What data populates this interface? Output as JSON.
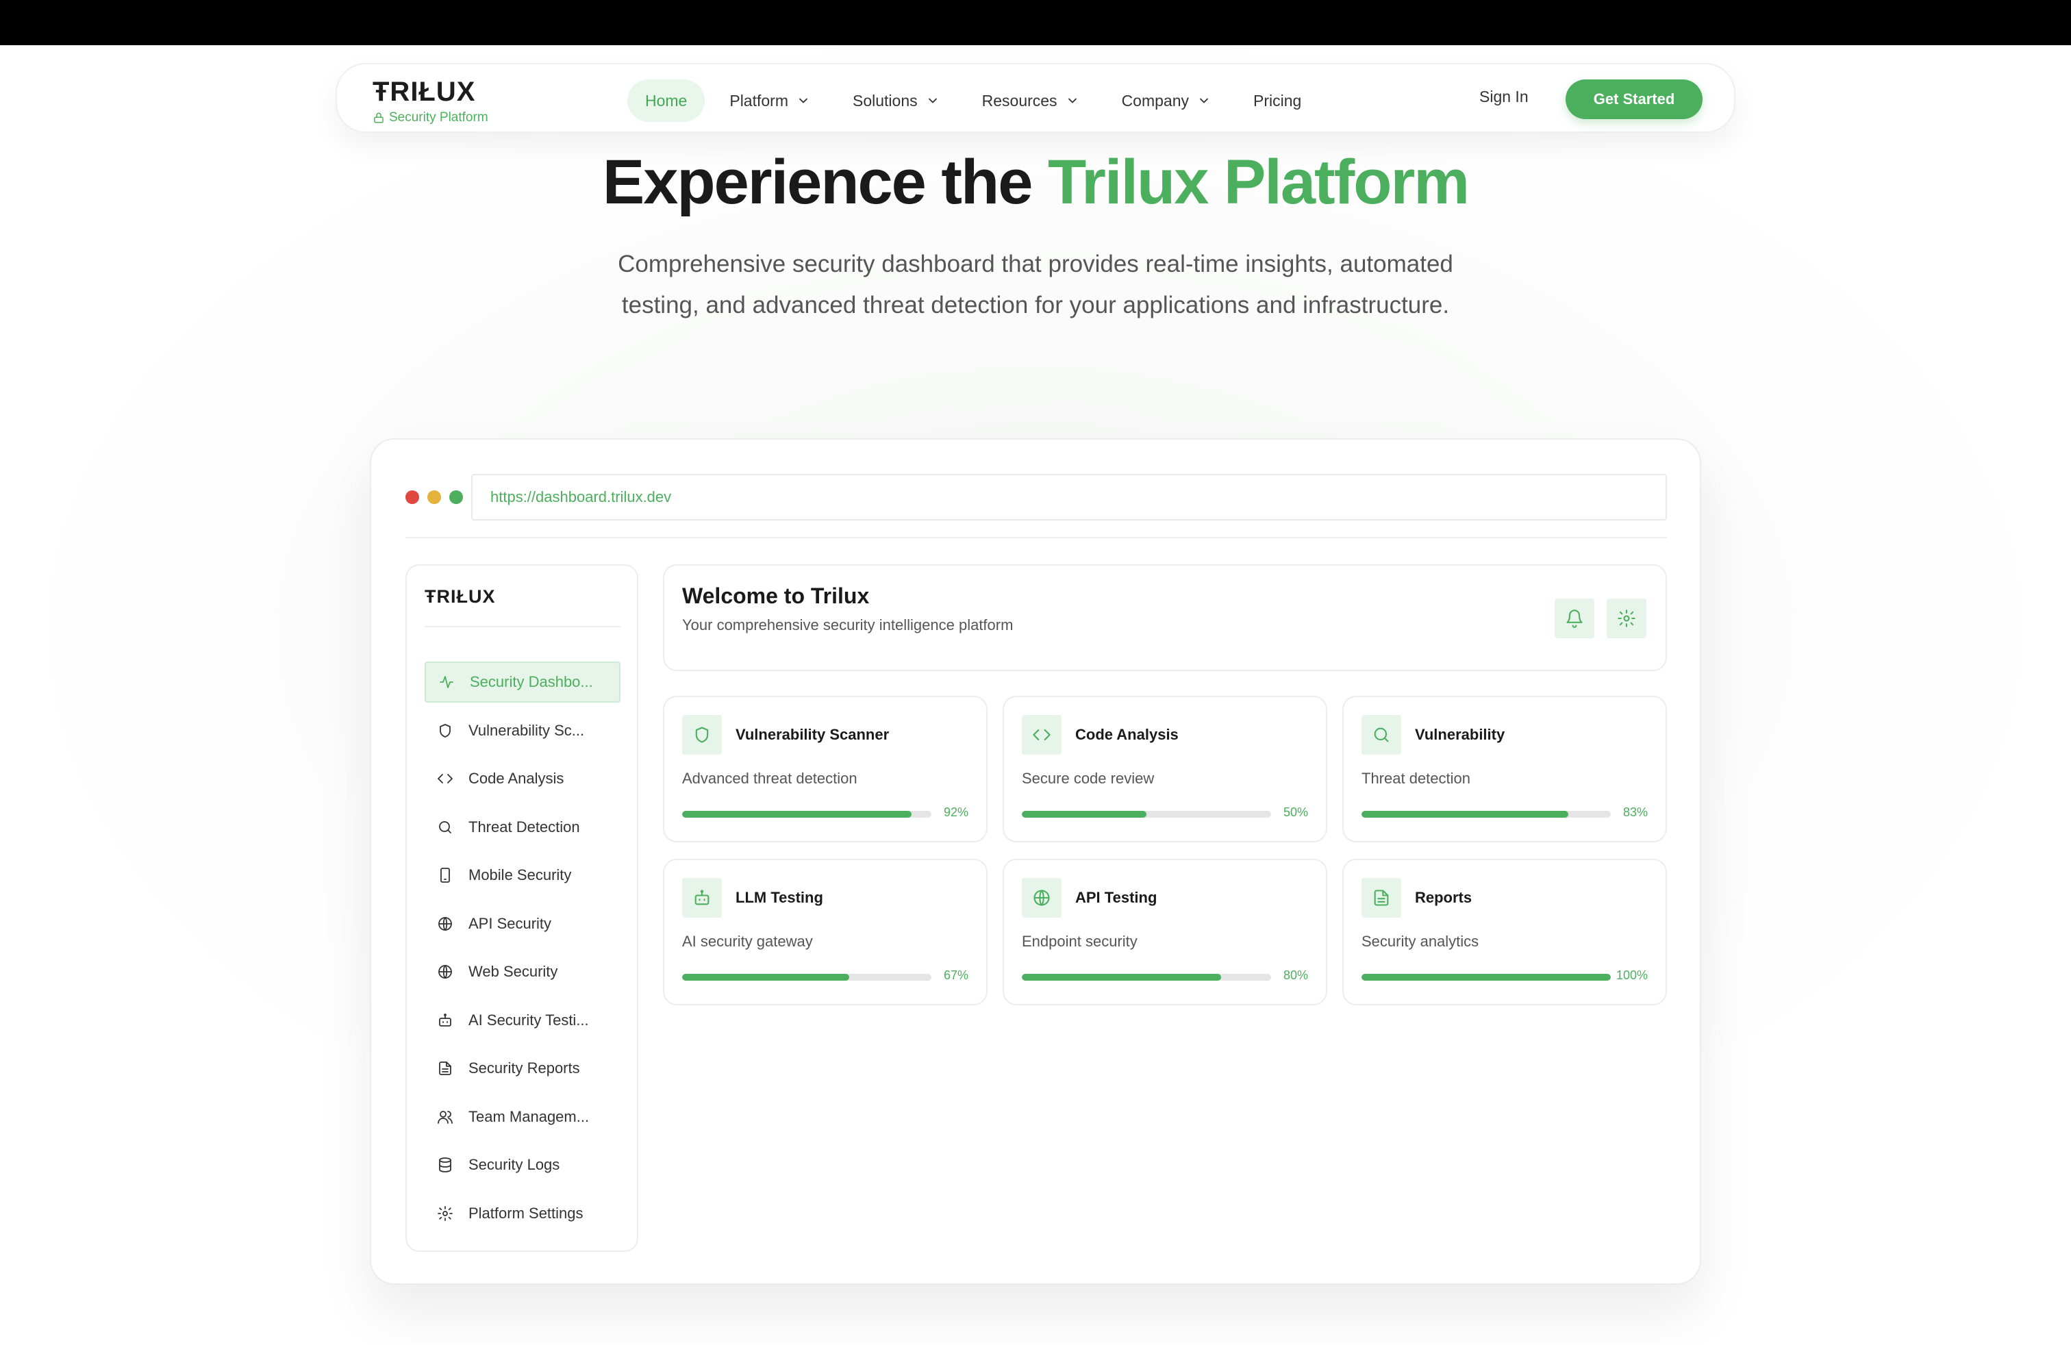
{
  "nav": {
    "logo": "ŦRIŁUX",
    "logo_sub": "Security Platform",
    "items": [
      {
        "label": "Home",
        "active": true,
        "dropdown": false
      },
      {
        "label": "Platform",
        "active": false,
        "dropdown": true
      },
      {
        "label": "Solutions",
        "active": false,
        "dropdown": true
      },
      {
        "label": "Resources",
        "active": false,
        "dropdown": true
      },
      {
        "label": "Company",
        "active": false,
        "dropdown": true
      },
      {
        "label": "Pricing",
        "active": false,
        "dropdown": false
      }
    ],
    "sign_in": "Sign In",
    "cta": "Get Started"
  },
  "hero": {
    "title_main": "Experience the ",
    "title_accent": "Trilux Platform",
    "subtitle": "Comprehensive security dashboard that provides real-time insights, automated testing, and advanced threat detection for your applications and infrastructure."
  },
  "window": {
    "url": "https://dashboard.trilux.dev",
    "dot_colors": [
      "#e0483f",
      "#e5b23b",
      "#4caf5d"
    ]
  },
  "sidebar": {
    "logo": "ŦRIŁUX",
    "items": [
      {
        "label": "Security Dashbo...",
        "icon": "activity-icon",
        "active": true
      },
      {
        "label": "Vulnerability Sc...",
        "icon": "shield-icon",
        "active": false
      },
      {
        "label": "Code Analysis",
        "icon": "code-icon",
        "active": false
      },
      {
        "label": "Threat Detection",
        "icon": "search-icon",
        "active": false
      },
      {
        "label": "Mobile Security",
        "icon": "smartphone-icon",
        "active": false
      },
      {
        "label": "API Security",
        "icon": "globe-icon",
        "active": false
      },
      {
        "label": "Web Security",
        "icon": "globe-icon",
        "active": false
      },
      {
        "label": "AI Security Testi...",
        "icon": "bot-icon",
        "active": false
      },
      {
        "label": "Security Reports",
        "icon": "file-text-icon",
        "active": false
      },
      {
        "label": "Team Managem...",
        "icon": "users-icon",
        "active": false
      },
      {
        "label": "Security Logs",
        "icon": "database-icon",
        "active": false
      },
      {
        "label": "Platform Settings",
        "icon": "gear-icon",
        "active": false
      }
    ]
  },
  "welcome": {
    "title": "Welcome to Trilux",
    "subtitle": "Your comprehensive security intelligence platform"
  },
  "cards": [
    {
      "title": "Vulnerability Scanner",
      "desc": "Advanced threat detection",
      "progress": 92,
      "progress_label": "92%",
      "icon": "shield-icon"
    },
    {
      "title": "Code Analysis",
      "desc": "Secure code review",
      "progress": 50,
      "progress_label": "50%",
      "icon": "code-icon"
    },
    {
      "title": "Vulnerability",
      "desc": "Threat detection",
      "progress": 83,
      "progress_label": "83%",
      "icon": "search-icon"
    },
    {
      "title": "LLM Testing",
      "desc": "AI security gateway",
      "progress": 67,
      "progress_label": "67%",
      "icon": "bot-icon"
    },
    {
      "title": "API Testing",
      "desc": "Endpoint security",
      "progress": 80,
      "progress_label": "80%",
      "icon": "globe-icon"
    },
    {
      "title": "Reports",
      "desc": "Security analytics",
      "progress": 100,
      "progress_label": "100%",
      "icon": "file-text-icon"
    }
  ],
  "colors": {
    "accent": "#4caf5d",
    "accent_light": "#e6f4e9"
  }
}
